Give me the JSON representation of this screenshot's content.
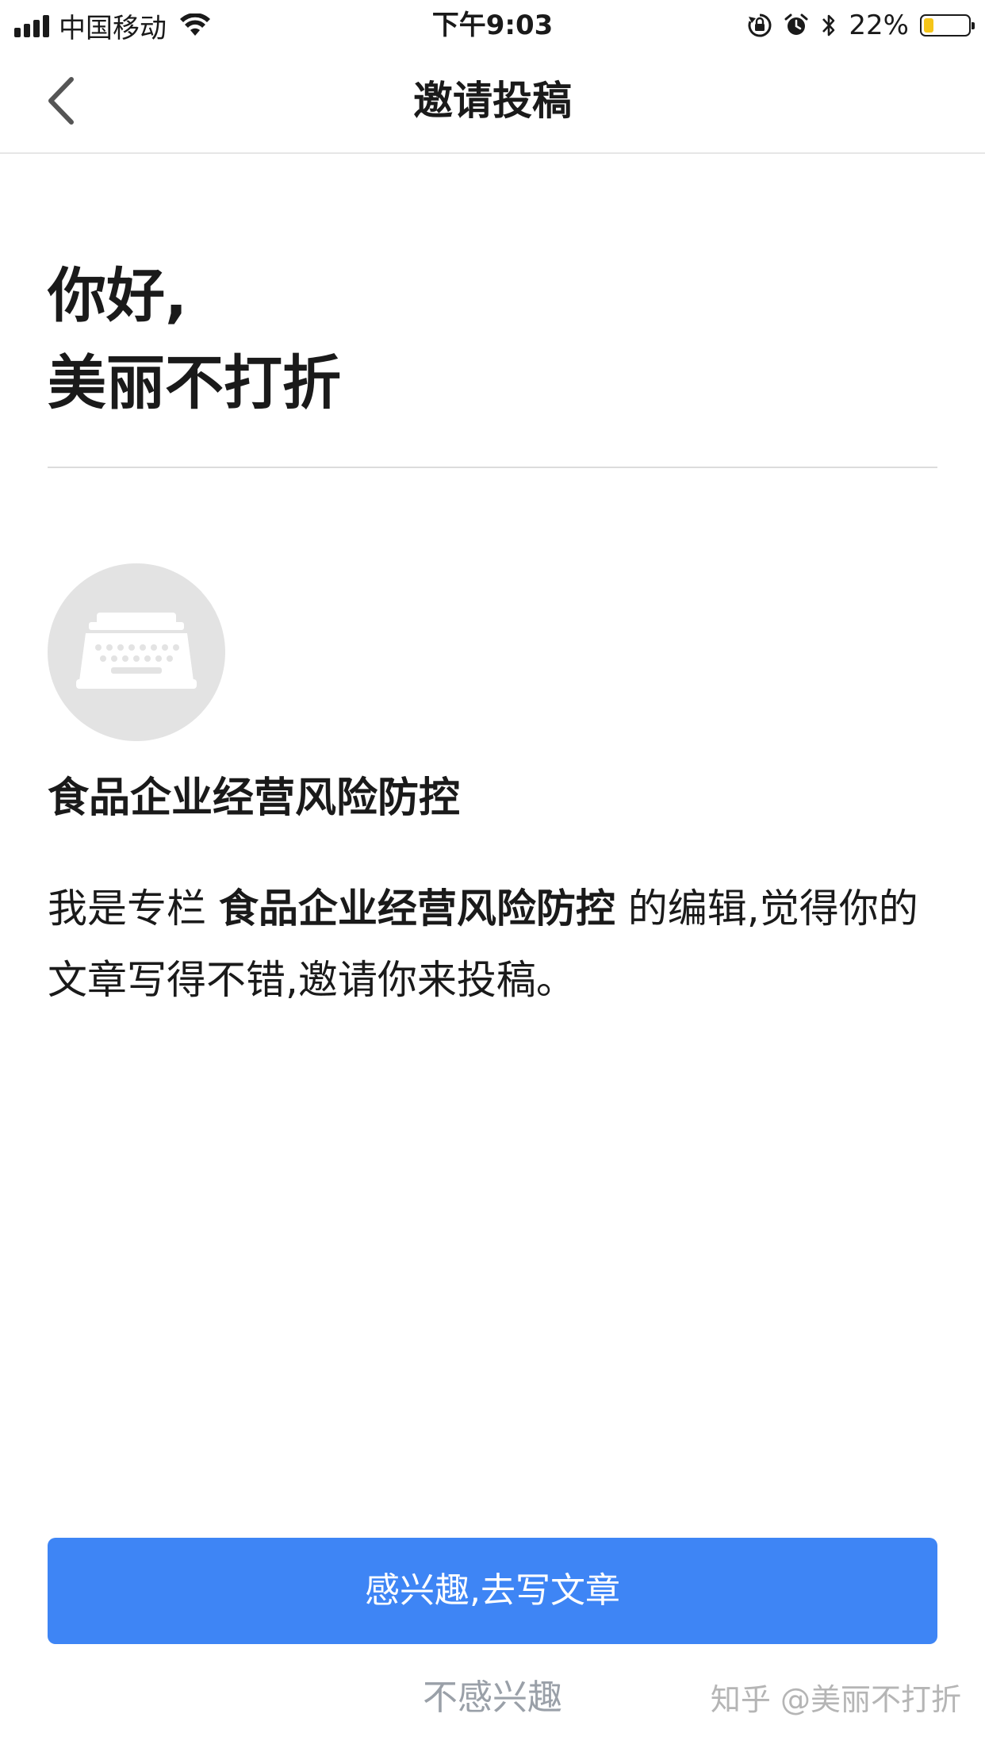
{
  "status_bar": {
    "carrier": "中国移动",
    "time": "下午9:03",
    "battery_percent": "22%",
    "battery_level": 0.22,
    "icons": [
      "signal-icon",
      "wifi-icon",
      "orientation-lock-icon",
      "alarm-icon",
      "bluetooth-icon",
      "battery-icon"
    ]
  },
  "nav": {
    "title": "邀请投稿",
    "back_icon": "chevron-left-icon"
  },
  "greeting": {
    "line1": "你好,",
    "line2": "美丽不打折"
  },
  "column": {
    "avatar_icon": "typewriter-icon",
    "name": "食品企业经营风险防控"
  },
  "invite": {
    "prefix": "我是专栏 ",
    "column_name": "食品企业经营风险防控",
    "suffix": " 的编辑,觉得你的文章写得不错,邀请你来投稿。"
  },
  "actions": {
    "accept_label": "感兴趣,去写文章",
    "decline_label": "不感兴趣"
  },
  "watermark": "知乎 @美丽不打折",
  "colors": {
    "primary": "#3e85f5",
    "avatar_bg": "#e3e3e3",
    "battery_fill": "#f5c518",
    "muted_text": "#9aa0a8"
  }
}
